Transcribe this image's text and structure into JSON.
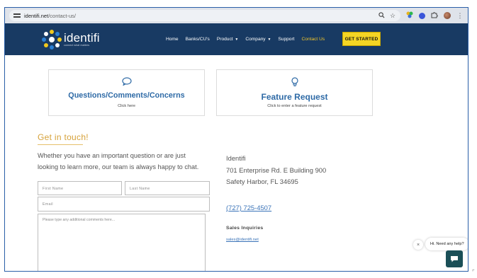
{
  "browser": {
    "url_domain": "identifi.net",
    "url_path": "/contact-us/",
    "icons": [
      "tune-icon",
      "zoom-icon",
      "star-icon",
      "extension-icon",
      "extension-icon",
      "puzzle-icon",
      "profile-avatar",
      "more-icon"
    ]
  },
  "header": {
    "logo_name": "identifi",
    "logo_tagline": "connect what matters",
    "nav": [
      {
        "label": "Home"
      },
      {
        "label": "Banks/CU's"
      },
      {
        "label": "Product",
        "caret": "▼"
      },
      {
        "label": "Company",
        "caret": "▼"
      },
      {
        "label": "Support"
      },
      {
        "label": "Contact Us"
      }
    ],
    "cta_label": "GET STARTED"
  },
  "cards": [
    {
      "title": "Questions/Comments/Concerns",
      "subtitle": "Click here",
      "icon": "chat-bubble-icon"
    },
    {
      "title": "Feature Request",
      "subtitle": "Click to enter a feature request",
      "icon": "lightbulb-icon"
    }
  ],
  "contact": {
    "heading": "Get in touch!",
    "intro": "Whether you have an important question or are just looking to learn more, our team is always happy to chat.",
    "first_name_placeholder": "First Name",
    "last_name_placeholder": "Last Name",
    "email_placeholder": "Email",
    "comments_placeholder": "Please type any additional comments here..."
  },
  "address": {
    "company": "Identifi",
    "street": "701 Enterprise Rd. E Building 900",
    "city": "Safety Harbor, FL 34695",
    "phone": "(727) 725-4507",
    "sales_heading": "Sales Inquiries",
    "sales_email": "sales@identifi.net"
  },
  "chat": {
    "close": "×",
    "message": "Hi. Need any help?"
  },
  "colors": {
    "header_bg": "#183a63",
    "accent_yellow": "#f5d524",
    "link_blue": "#2e6aa6",
    "heading_gold": "#d6a23a",
    "chat_teal": "#1a4f57"
  }
}
